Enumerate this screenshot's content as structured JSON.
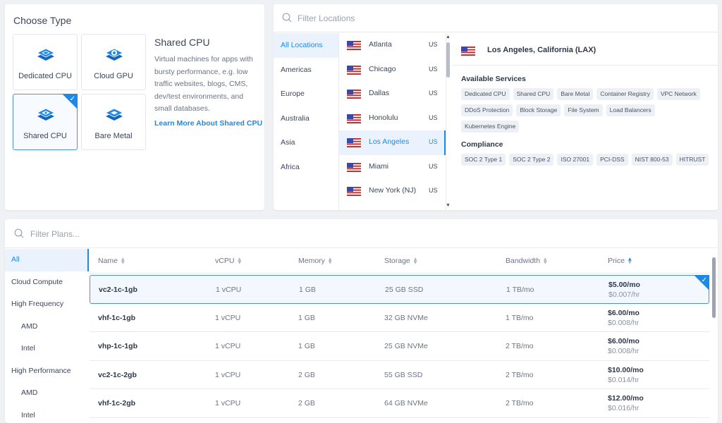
{
  "type_panel": {
    "title": "Choose Type",
    "types": [
      {
        "label": "Dedicated CPU",
        "icon": "dedicated-cpu-icon"
      },
      {
        "label": "Cloud GPU",
        "icon": "cloud-gpu-icon"
      },
      {
        "label": "Shared CPU",
        "icon": "shared-cpu-icon",
        "selected": true
      },
      {
        "label": "Bare Metal",
        "icon": "bare-metal-icon"
      }
    ],
    "description_title": "Shared CPU",
    "description": "Virtual machines for apps with bursty performance, e.g. low traffic websites, blogs, CMS, dev/test environments, and small databases.",
    "learn_more": "Learn More About Shared CPU"
  },
  "locations": {
    "search_placeholder": "Filter Locations",
    "regions": [
      "All Locations",
      "Americas",
      "Europe",
      "Australia",
      "Asia",
      "Africa"
    ],
    "active_region": "All Locations",
    "cities": [
      {
        "name": "Atlanta",
        "country": "US"
      },
      {
        "name": "Chicago",
        "country": "US"
      },
      {
        "name": "Dallas",
        "country": "US"
      },
      {
        "name": "Honolulu",
        "country": "US"
      },
      {
        "name": "Los Angeles",
        "country": "US"
      },
      {
        "name": "Miami",
        "country": "US"
      },
      {
        "name": "New York (NJ)",
        "country": "US"
      }
    ],
    "active_city": "Los Angeles",
    "detail": {
      "title": "Los Angeles, California (LAX)",
      "services_label": "Available Services",
      "services": [
        "Dedicated CPU",
        "Shared CPU",
        "Bare Metal",
        "Container Registry",
        "VPC Network",
        "DDoS Protection",
        "Block Storage",
        "File System",
        "Load Balancers",
        "Kubernetes Engine"
      ],
      "compliance_label": "Compliance",
      "compliance": [
        "SOC 2 Type 1",
        "SOC 2 Type 2",
        "ISO 27001",
        "PCI-DSS",
        "NIST 800-53",
        "HITRUST"
      ]
    }
  },
  "plans": {
    "search_placeholder": "Filter Plans...",
    "categories": [
      {
        "label": "All",
        "active": true
      },
      {
        "label": "Cloud Compute"
      },
      {
        "label": "High Frequency"
      },
      {
        "label": "AMD",
        "sub": true
      },
      {
        "label": "Intel",
        "sub": true
      },
      {
        "label": "High Performance"
      },
      {
        "label": "AMD",
        "sub": true
      },
      {
        "label": "Intel",
        "sub": true
      }
    ],
    "columns": [
      "Name",
      "vCPU",
      "Memory",
      "Storage",
      "Bandwidth",
      "Price"
    ],
    "sorted_column": "Price",
    "rows": [
      {
        "name": "vc2-1c-1gb",
        "vcpu": "1 vCPU",
        "memory": "1 GB",
        "storage": "25 GB SSD",
        "bandwidth": "1 TB/mo",
        "price_mo": "$5.00/mo",
        "price_hr": "$0.007/hr",
        "selected": true
      },
      {
        "name": "vhf-1c-1gb",
        "vcpu": "1 vCPU",
        "memory": "1 GB",
        "storage": "32 GB NVMe",
        "bandwidth": "1 TB/mo",
        "price_mo": "$6.00/mo",
        "price_hr": "$0.008/hr"
      },
      {
        "name": "vhp-1c-1gb",
        "vcpu": "1 vCPU",
        "memory": "1 GB",
        "storage": "25 GB NVMe",
        "bandwidth": "2 TB/mo",
        "price_mo": "$6.00/mo",
        "price_hr": "$0.008/hr"
      },
      {
        "name": "vc2-1c-2gb",
        "vcpu": "1 vCPU",
        "memory": "2 GB",
        "storage": "55 GB SSD",
        "bandwidth": "2 TB/mo",
        "price_mo": "$10.00/mo",
        "price_hr": "$0.014/hr"
      },
      {
        "name": "vhf-1c-2gb",
        "vcpu": "1 vCPU",
        "memory": "2 GB",
        "storage": "64 GB NVMe",
        "bandwidth": "2 TB/mo",
        "price_mo": "$12.00/mo",
        "price_hr": "$0.016/hr"
      }
    ]
  },
  "colors": {
    "accent": "#1e88e5",
    "selected_bg": "#eaf3fd"
  }
}
